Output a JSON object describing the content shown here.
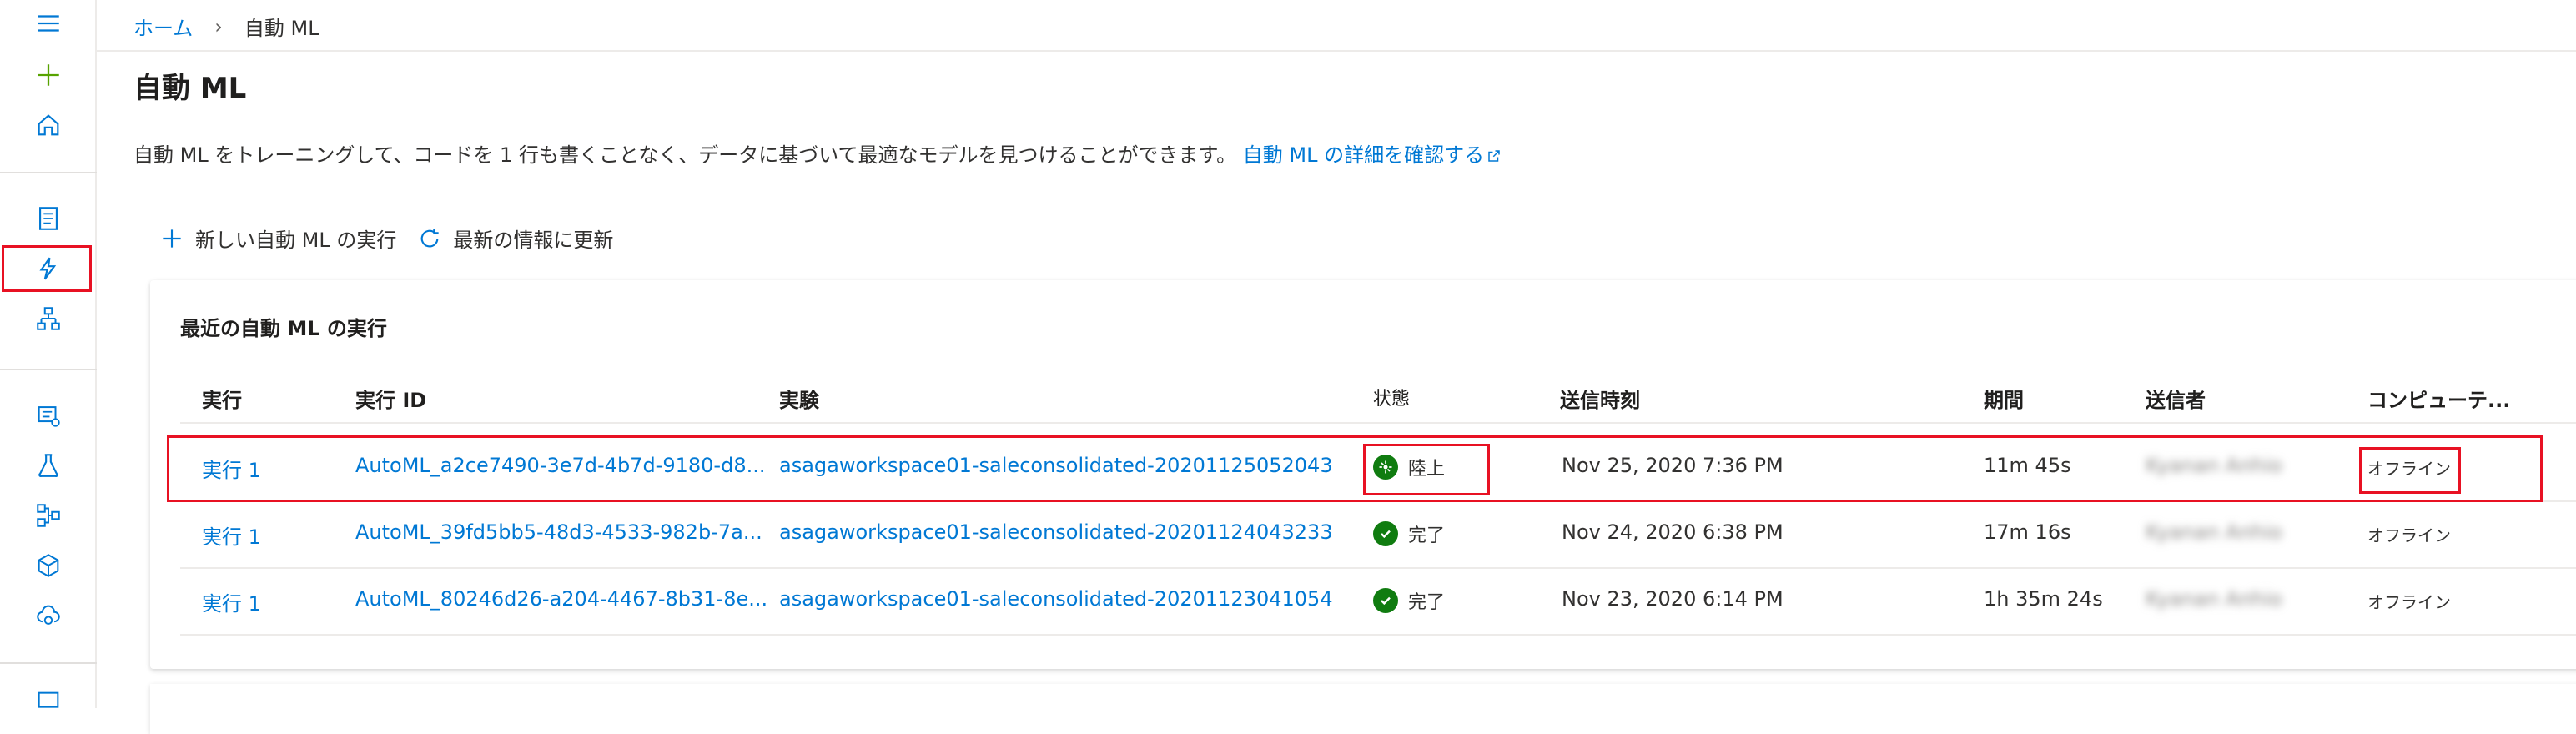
{
  "breadcrumb": {
    "home": "ホーム",
    "separator": "›",
    "current": "自動 ML"
  },
  "page": {
    "title": "自動 ML",
    "description": "自動 ML をトレーニングして、コードを 1 行も書くことなく、データに基づいて最適なモデルを見つけることができます。",
    "learn_more": "自動 ML の詳細を確認する"
  },
  "commands": {
    "new_run": "新しい自動 ML の実行",
    "refresh": "最新の情報に更新"
  },
  "recent": {
    "title": "最近の自動 ML の実行",
    "columns": [
      "実行",
      "実行 ID",
      "実験",
      "状態",
      "送信時刻",
      "期間",
      "送信者",
      "コンピューテ..."
    ],
    "rows": [
      {
        "run": "実行 1",
        "run_id": "AutoML_a2ce7490-3e7d-4b7d-9180-d8...",
        "experiment": "asagaworkspace01-saleconsolidated-20201125052043",
        "status": "陸上",
        "status_icon": "running-icon",
        "submitted": "Nov 25, 2020 7:36 PM",
        "duration": "11m 45s",
        "submitter": "Kyanan Anhio",
        "compute": "オフライン"
      },
      {
        "run": "実行 1",
        "run_id": "AutoML_39fd5bb5-48d3-4533-982b-7a...",
        "experiment": "asagaworkspace01-saleconsolidated-20201124043233",
        "status": "完了",
        "status_icon": "check-icon",
        "submitted": "Nov 24, 2020 6:38 PM",
        "duration": "17m 16s",
        "submitter": "Kyanan Anhio",
        "compute": "オフライン"
      },
      {
        "run": "実行 1",
        "run_id": "AutoML_80246d26-a204-4467-8b31-8e...",
        "experiment": "asagaworkspace01-saleconsolidated-20201123041054",
        "status": "完了",
        "status_icon": "check-icon",
        "submitted": "Nov 23, 2020 6:14 PM",
        "duration": "1h 35m 24s",
        "submitter": "Kyanan Anhio",
        "compute": "オフライン"
      }
    ]
  },
  "colors": {
    "accent": "#0078d4",
    "success": "#107c10",
    "highlight": "#e81123"
  }
}
